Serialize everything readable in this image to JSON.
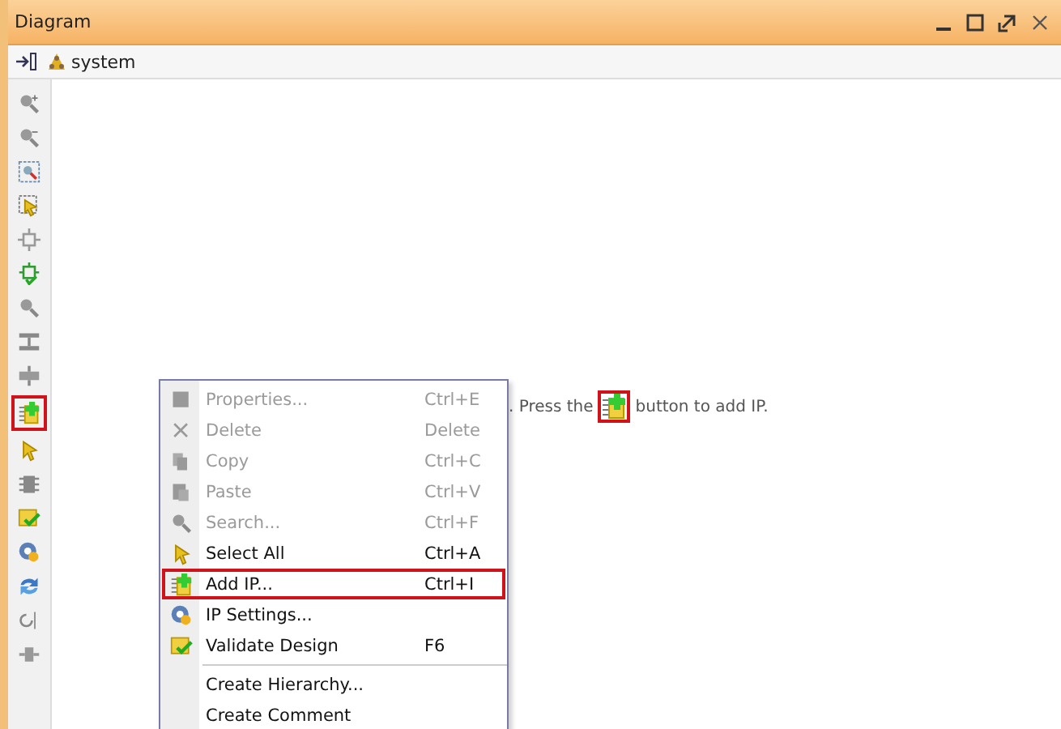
{
  "window": {
    "title": "Diagram"
  },
  "breadcrumb": {
    "label": "system"
  },
  "tools": [
    {
      "kind": "zoom-in",
      "highlighted": false
    },
    {
      "kind": "zoom-out",
      "highlighted": false
    },
    {
      "kind": "zoom-fit",
      "highlighted": false
    },
    {
      "kind": "select-area",
      "highlighted": false
    },
    {
      "kind": "autoconnect",
      "highlighted": false
    },
    {
      "kind": "regenerate",
      "highlighted": false
    },
    {
      "kind": "search",
      "highlighted": false
    },
    {
      "kind": "expand",
      "highlighted": false
    },
    {
      "kind": "collapse",
      "highlighted": false
    },
    {
      "kind": "add-ip",
      "highlighted": true
    },
    {
      "kind": "pointer",
      "highlighted": false
    },
    {
      "kind": "chip",
      "highlighted": false
    },
    {
      "kind": "validate",
      "highlighted": false
    },
    {
      "kind": "settings",
      "highlighted": false
    },
    {
      "kind": "refresh",
      "highlighted": false
    },
    {
      "kind": "hook",
      "highlighted": false
    },
    {
      "kind": "port",
      "highlighted": false
    }
  ],
  "hint": {
    "before": ". Press the",
    "after": "button to add IP.",
    "icon_highlighted": true
  },
  "context_menu": {
    "items": [
      {
        "label": "Properties...",
        "shortcut": "Ctrl+E",
        "disabled": true,
        "highlighted": false,
        "kind": "properties"
      },
      {
        "label": "Delete",
        "shortcut": "Delete",
        "disabled": true,
        "highlighted": false,
        "kind": "delete"
      },
      {
        "label": "Copy",
        "shortcut": "Ctrl+C",
        "disabled": true,
        "highlighted": false,
        "kind": "copy"
      },
      {
        "label": "Paste",
        "shortcut": "Ctrl+V",
        "disabled": true,
        "highlighted": false,
        "kind": "paste"
      },
      {
        "label": "Search...",
        "shortcut": "Ctrl+F",
        "disabled": true,
        "highlighted": false,
        "kind": "search"
      },
      {
        "label": "Select All",
        "shortcut": "Ctrl+A",
        "disabled": false,
        "highlighted": false,
        "kind": "pointer"
      },
      {
        "label": "Add IP...",
        "shortcut": "Ctrl+I",
        "disabled": false,
        "highlighted": true,
        "kind": "add-ip"
      },
      {
        "label": "IP Settings...",
        "disabled": false,
        "highlighted": false,
        "kind": "settings"
      },
      {
        "label": "Validate Design",
        "shortcut": "F6",
        "disabled": false,
        "highlighted": false,
        "kind": "validate"
      },
      {
        "label": "Create Hierarchy...",
        "disabled": false,
        "highlighted": false,
        "separator_before": true
      },
      {
        "label": "Create Comment",
        "disabled": false,
        "highlighted": false
      }
    ]
  }
}
